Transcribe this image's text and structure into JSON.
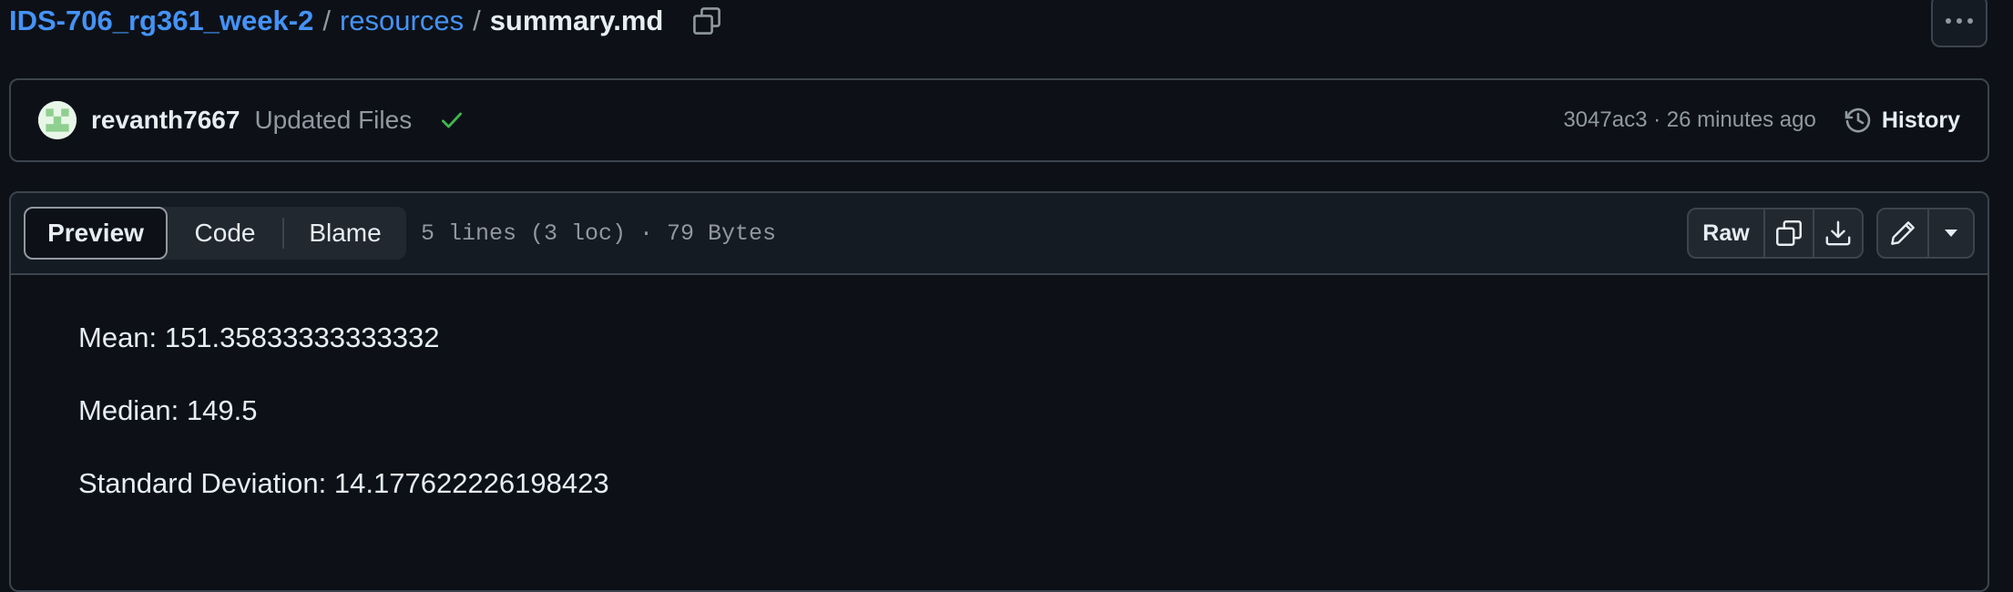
{
  "breadcrumb": {
    "repo": "IDS-706_rg361_week-2",
    "separator": "/",
    "folder": "resources",
    "file": "summary.md"
  },
  "icons": {
    "copy_path": "copy-icon",
    "more": "kebab-horizontal-icon",
    "check": "check-icon",
    "history": "history-icon",
    "copy_raw": "copy-icon",
    "download": "download-icon",
    "edit": "pencil-icon",
    "caret": "triangle-down-icon"
  },
  "commit": {
    "author": "revanth7667",
    "message": "Updated Files",
    "meta": "3047ac3 · 26 minutes ago",
    "history_label": "History"
  },
  "file_header": {
    "tabs": [
      {
        "label": "Preview",
        "active": true
      },
      {
        "label": "Code",
        "active": false
      },
      {
        "label": "Blame",
        "active": false
      }
    ],
    "info": "5 lines (3 loc) · 79 Bytes",
    "raw_label": "Raw"
  },
  "content": {
    "lines": [
      "Mean: 151.35833333333332",
      "Median: 149.5",
      "Standard Deviation: 14.177622226198423"
    ]
  },
  "colors": {
    "background": "#0d1117",
    "link": "#4493f8",
    "success": "#3fb950",
    "border": "#3d444d",
    "muted": "#9198a1"
  }
}
